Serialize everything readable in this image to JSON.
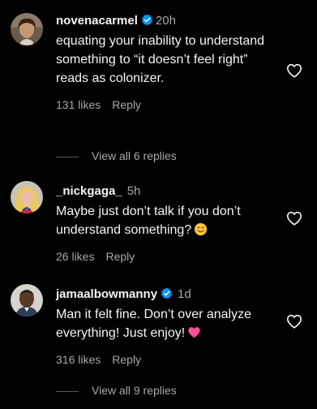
{
  "comments": [
    {
      "username": "novenacarmel",
      "verified": true,
      "time": "20h",
      "text": "equating your inability to understand something to “it doesn’t feel right” reads as colonizer.",
      "likes": "131 likes",
      "reply": "Reply",
      "view_replies": "View all 6 replies"
    },
    {
      "username": "_nickgaga_",
      "verified": false,
      "time": "5h",
      "text": "Maybe just don’t talk if you don’t understand something?",
      "emoji": "smiling-face-emoji",
      "likes": "26 likes",
      "reply": "Reply"
    },
    {
      "username": "jamaalbowmanny",
      "verified": true,
      "time": "1d",
      "text": "Man it felt fine. Don’t over analyze everything! Just enjoy!",
      "emoji": "pink-heart-emoji",
      "likes": "316 likes",
      "reply": "Reply",
      "view_replies": "View all 9 replies"
    }
  ],
  "icons": {
    "like": "heart-outline-icon",
    "verified": "verified-badge-icon"
  },
  "colors": {
    "background": "#000000",
    "primary_text": "#f5f5f5",
    "secondary_text": "#a8a8a8",
    "verified_blue": "#0095f6",
    "emoji_heart": "#ff4f9a"
  }
}
